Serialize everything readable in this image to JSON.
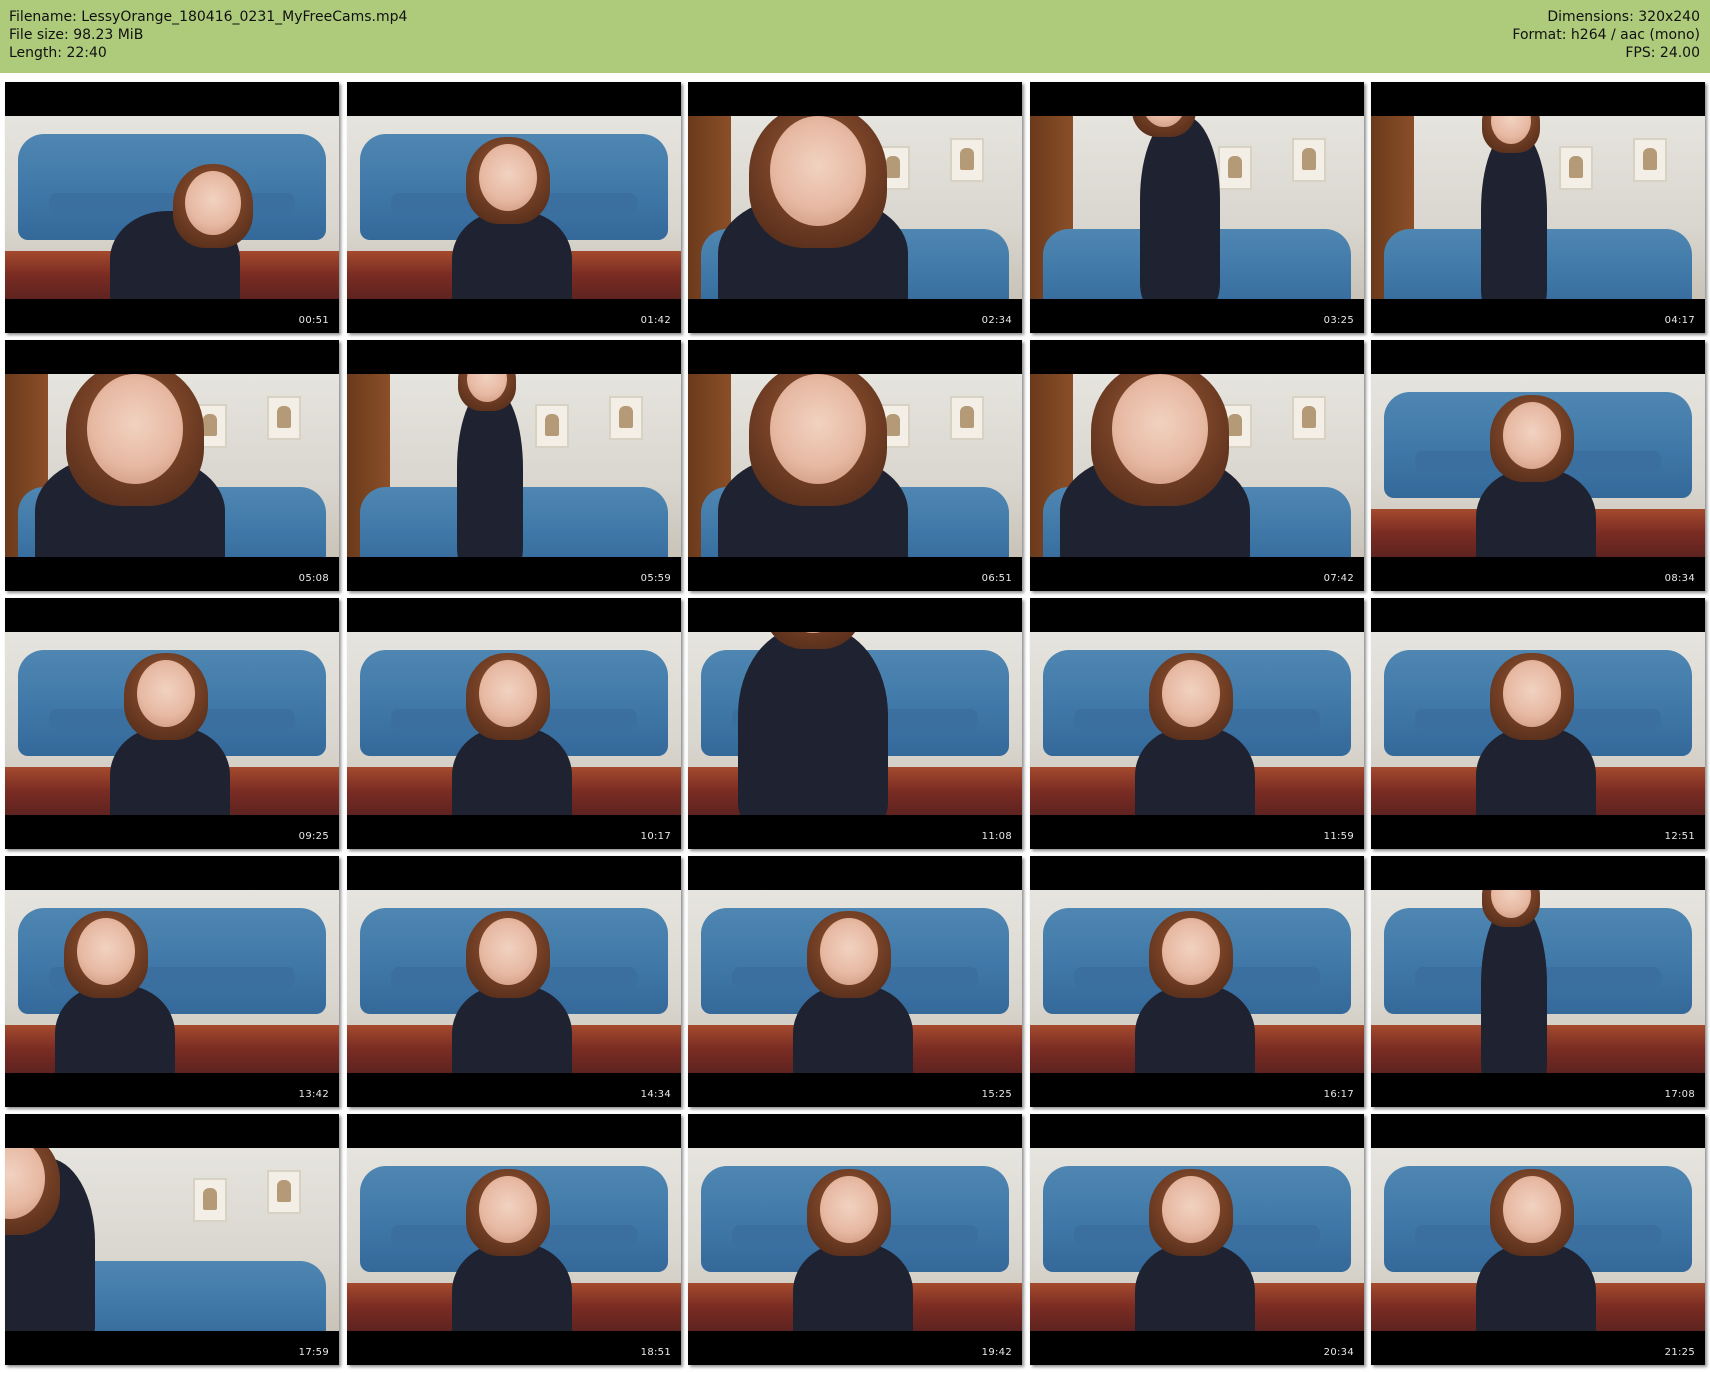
{
  "header": {
    "filename_line": "Filename: LessyOrange_180416_0231_MyFreeCams.mp4",
    "filesize_line": "File size: 98.23 MiB",
    "length_line": "Length: 22:40",
    "dimensions_line": "Dimensions: 320x240",
    "format_line": "Format: h264 / aac (mono)",
    "fps_line": "FPS: 24.00"
  },
  "thumbnails": [
    {
      "time": "00:51",
      "scene": "sofa",
      "pose": "floor"
    },
    {
      "time": "01:42",
      "scene": "sofa",
      "pose": "sitting"
    },
    {
      "time": "02:34",
      "scene": "wall",
      "pose": "close"
    },
    {
      "time": "03:25",
      "scene": "wall",
      "pose": "standing-back"
    },
    {
      "time": "04:17",
      "scene": "wall",
      "pose": "standing"
    },
    {
      "time": "05:08",
      "scene": "wall",
      "pose": "close"
    },
    {
      "time": "05:59",
      "scene": "wall",
      "pose": "standing"
    },
    {
      "time": "06:51",
      "scene": "wall",
      "pose": "close"
    },
    {
      "time": "07:42",
      "scene": "wall",
      "pose": "close"
    },
    {
      "time": "08:34",
      "scene": "sofa",
      "pose": "sitting"
    },
    {
      "time": "09:25",
      "scene": "sofa",
      "pose": "sitting"
    },
    {
      "time": "10:17",
      "scene": "sofa",
      "pose": "sitting"
    },
    {
      "time": "11:08",
      "scene": "sofa",
      "pose": "torso"
    },
    {
      "time": "11:59",
      "scene": "sofa",
      "pose": "sitting"
    },
    {
      "time": "12:51",
      "scene": "sofa",
      "pose": "sitting"
    },
    {
      "time": "13:42",
      "scene": "sofa",
      "pose": "sitting-left"
    },
    {
      "time": "14:34",
      "scene": "sofa",
      "pose": "sitting"
    },
    {
      "time": "15:25",
      "scene": "sofa",
      "pose": "sitting"
    },
    {
      "time": "16:17",
      "scene": "sofa",
      "pose": "sitting"
    },
    {
      "time": "17:08",
      "scene": "sofa",
      "pose": "standing"
    },
    {
      "time": "17:59",
      "scene": "wall",
      "pose": "left-edge"
    },
    {
      "time": "18:51",
      "scene": "sofa",
      "pose": "sitting"
    },
    {
      "time": "19:42",
      "scene": "sofa",
      "pose": "sitting"
    },
    {
      "time": "20:34",
      "scene": "sofa",
      "pose": "sitting"
    },
    {
      "time": "21:25",
      "scene": "sofa",
      "pose": "sitting"
    }
  ]
}
